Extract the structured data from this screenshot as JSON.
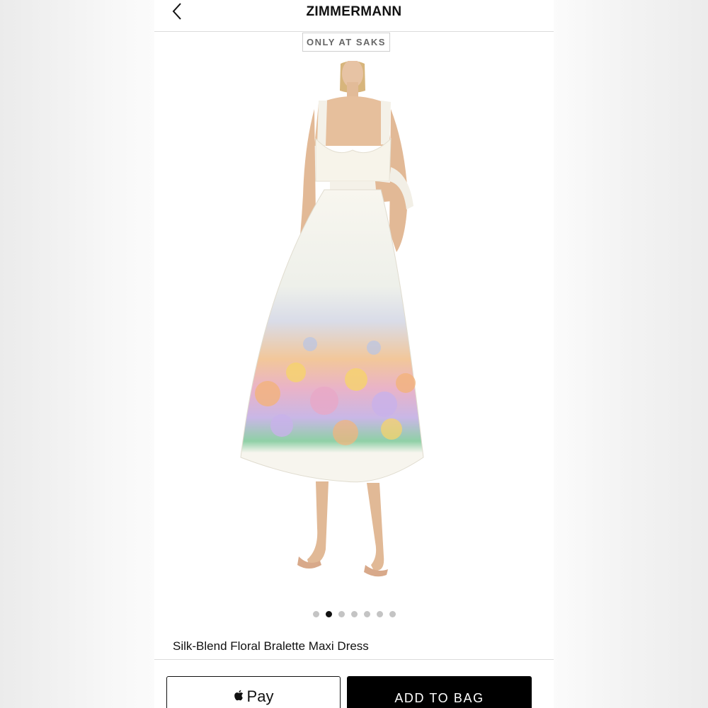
{
  "header": {
    "back_icon": "chevron-left-icon",
    "brand": "ZIMMERMANN"
  },
  "badge": {
    "label": "ONLY AT SAKS"
  },
  "gallery": {
    "image_subject": "model wearing floral maxi dress",
    "total_images": 7,
    "active_index": 1
  },
  "product": {
    "name": "Silk-Blend Floral Bralette Maxi Dress"
  },
  "actions": {
    "apple_pay_icon": "apple-icon",
    "apple_pay_label": "Pay",
    "add_to_bag_label": "ADD TO BAG"
  },
  "colors": {
    "accent": "#000000",
    "dot_active": "#111111",
    "dot_inactive": "#c4c4c4"
  }
}
